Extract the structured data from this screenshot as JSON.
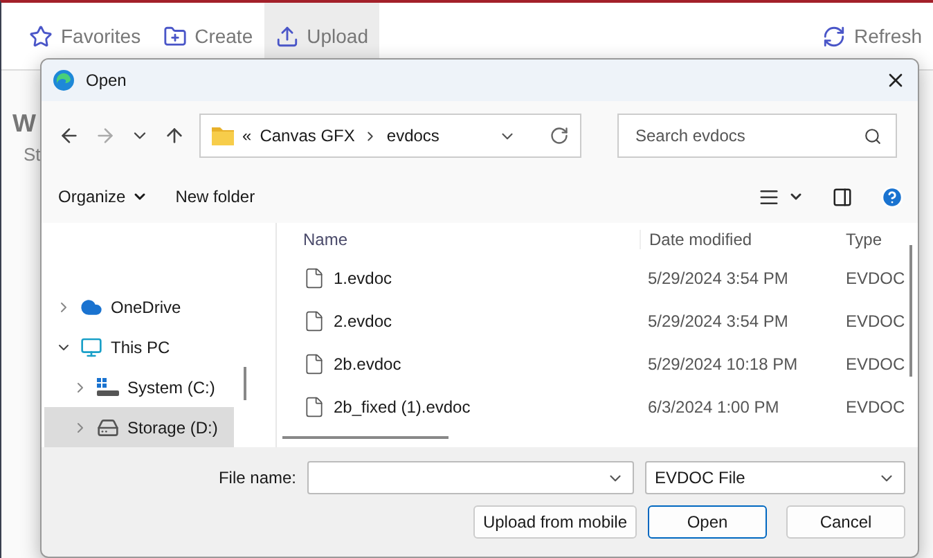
{
  "app": {
    "toolbar": [
      {
        "label": "Favorites",
        "kind": "star",
        "selected": false
      },
      {
        "label": "Create",
        "kind": "create",
        "selected": false
      },
      {
        "label": "Upload",
        "kind": "upload",
        "selected": true
      }
    ],
    "refresh": "Refresh",
    "heading": "W",
    "subheading": "St"
  },
  "dialog": {
    "title": "Open",
    "path_prefix": "«",
    "path": [
      "Canvas GFX",
      "evdocs"
    ],
    "search": {
      "placeholder": "Search evdocs"
    },
    "toolbar": {
      "organize": "Organize",
      "new_folder": "New folder"
    },
    "tree": [
      {
        "label": "OneDrive",
        "kind": "cloud",
        "expanded": false,
        "selected": false
      },
      {
        "label": "This PC",
        "kind": "pc",
        "expanded": true,
        "selected": false,
        "children": [
          {
            "label": "System (C:)",
            "kind": "system-drive",
            "expanded": false,
            "selected": false
          },
          {
            "label": "Storage (D:)",
            "kind": "drive",
            "expanded": false,
            "selected": true
          }
        ]
      }
    ],
    "columns": [
      "Name",
      "Date modified",
      "Type"
    ],
    "rows": [
      {
        "name": "1.evdoc",
        "date": "5/29/2024 3:54 PM",
        "type": "EVDOC"
      },
      {
        "name": "2.evdoc",
        "date": "5/29/2024 3:54 PM",
        "type": "EVDOC"
      },
      {
        "name": "2b.evdoc",
        "date": "5/29/2024 10:18 PM",
        "type": "EVDOC"
      },
      {
        "name": "2b_fixed (1).evdoc",
        "date": "6/3/2024 1:00 PM",
        "type": "EVDOC"
      }
    ],
    "file_name_label": "File name:",
    "filter": "EVDOC File",
    "buttons": [
      {
        "label": "Upload from mobile",
        "default": false
      },
      {
        "label": "Open",
        "default": true
      },
      {
        "label": "Cancel",
        "default": false
      }
    ]
  }
}
